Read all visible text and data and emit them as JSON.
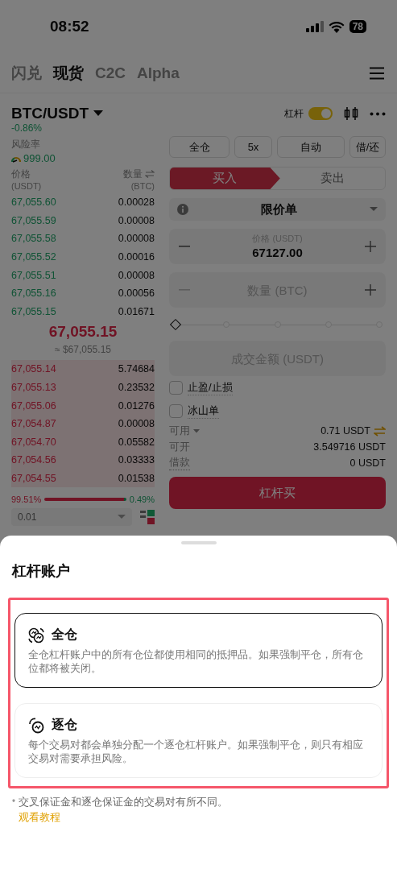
{
  "status_bar": {
    "time": "08:52",
    "battery": "78"
  },
  "nav": {
    "tabs": [
      {
        "label": "闪兑",
        "selected": false
      },
      {
        "label": "现货",
        "selected": true
      },
      {
        "label": "C2C",
        "selected": false
      },
      {
        "label": "Alpha",
        "selected": false
      }
    ]
  },
  "pair": {
    "symbol": "BTC/USDT",
    "change": "-0.86%",
    "leverage_label": "杠杆",
    "leverage_on": true
  },
  "risk": {
    "label": "风险率",
    "value": "999.00"
  },
  "orderbook": {
    "price_header": "价格",
    "price_unit": "(USDT)",
    "qty_header": "数量",
    "qty_unit": "(BTC)",
    "upper_rows": [
      {
        "price": "67,055.60",
        "qty": "0.00028"
      },
      {
        "price": "67,055.59",
        "qty": "0.00008"
      },
      {
        "price": "67,055.58",
        "qty": "0.00008"
      },
      {
        "price": "67,055.52",
        "qty": "0.00016"
      },
      {
        "price": "67,055.51",
        "qty": "0.00008"
      },
      {
        "price": "67,055.16",
        "qty": "0.00056"
      },
      {
        "price": "67,055.15",
        "qty": "0.01671"
      }
    ],
    "mid_price": "67,055.15",
    "mid_approx": "≈ $67,055.15",
    "lower_rows": [
      {
        "price": "67,055.14",
        "qty": "5.74684"
      },
      {
        "price": "67,055.13",
        "qty": "0.23532"
      },
      {
        "price": "67,055.06",
        "qty": "0.01276"
      },
      {
        "price": "67,054.87",
        "qty": "0.00008"
      },
      {
        "price": "67,054.70",
        "qty": "0.05582"
      },
      {
        "price": "67,054.56",
        "qty": "0.03333"
      },
      {
        "price": "67,054.55",
        "qty": "0.01538"
      }
    ],
    "ratio": {
      "red_label": "99.51%",
      "green_label": "0.49%"
    },
    "precision": "0.01"
  },
  "order_form": {
    "margin_buttons": [
      "全仓",
      "5x",
      "自动",
      "借/还"
    ],
    "side_tabs": [
      {
        "label": "买入",
        "selected": true
      },
      {
        "label": "卖出",
        "selected": false
      }
    ],
    "order_type": "限价单",
    "price": {
      "label": "价格 (USDT)",
      "value": "67127.00"
    },
    "quantity": {
      "placeholder": "数量 (BTC)"
    },
    "slider": {
      "level": 0
    },
    "amount": {
      "placeholder": "成交金额 (USDT)"
    },
    "options": [
      {
        "label": "止盈/止损",
        "checked": false
      },
      {
        "label": "冰山单",
        "checked": false
      }
    ],
    "info": [
      {
        "label": "可用",
        "value": "0.71 USDT",
        "kind": "available"
      },
      {
        "label": "可开",
        "value": "3.549716 USDT",
        "kind": "plain"
      },
      {
        "label": "借款",
        "value": "0 USDT",
        "kind": "dotted"
      }
    ],
    "submit": "杠杆买"
  },
  "sheet": {
    "title": "杠杆账户",
    "modes": [
      {
        "title": "全仓",
        "description": "全仓杠杆账户中的所有仓位都使用相同的抵押品。如果强制平仓，所有仓位都将被关闭。",
        "selected": true,
        "kind": "cross"
      },
      {
        "title": "逐仓",
        "description": "每个交易对都会单独分配一个逐仓杠杆账户。如果强制平仓，则只有相应交易对需要承担风险。",
        "selected": false,
        "kind": "isolated"
      }
    ],
    "note_mark": "*",
    "note": "交叉保证金和逐仓保证金的交易对有所不同。",
    "link": "观看教程"
  }
}
